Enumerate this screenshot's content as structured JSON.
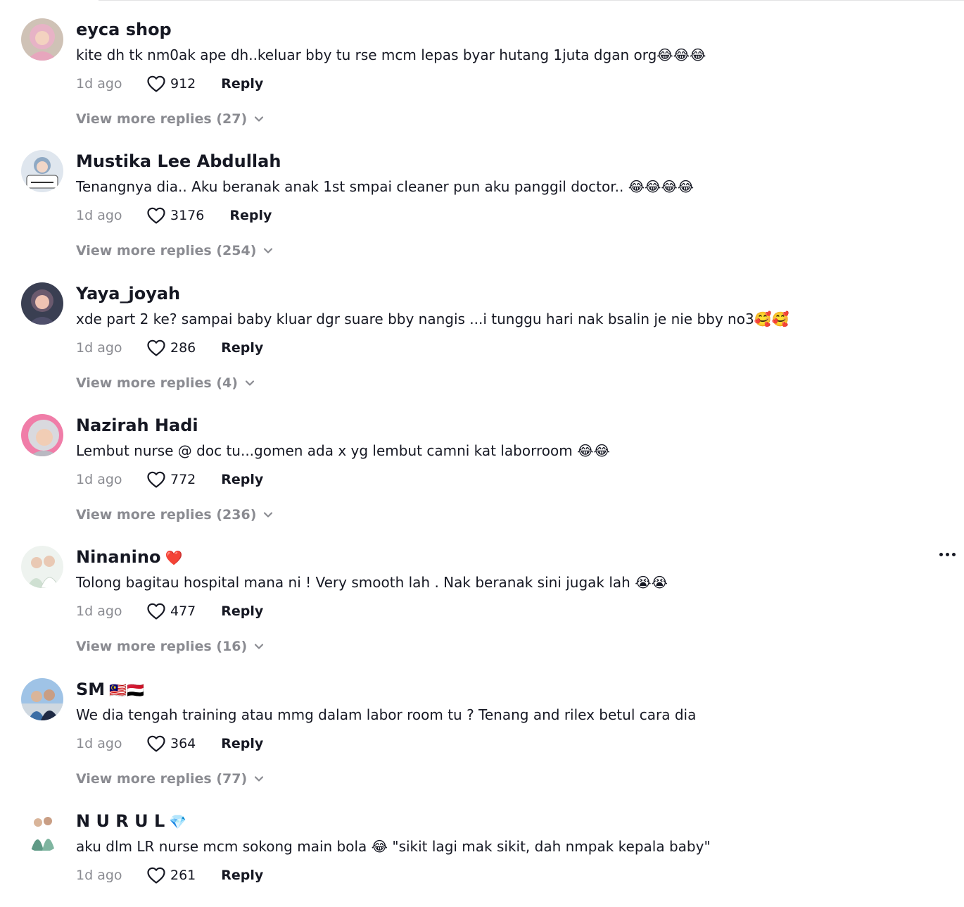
{
  "comments": [
    {
      "username": "eyca shop",
      "tag": "",
      "text": "kite dh tk nm0ak ape dh..keluar bby tu rse mcm lepas byar hutang 1juta dgan org😂😂😂",
      "time": "1d ago",
      "likes": "912",
      "reply_label": "Reply",
      "more_replies": "View more replies (27)",
      "avatar_color": "#e7b3c6"
    },
    {
      "username": "Mustika Lee Abdullah",
      "tag": "",
      "text": "Tenangnya dia.. Aku beranak anak 1st smpai cleaner pun aku panggil doctor.. 😂😂😂😂",
      "time": "1d ago",
      "likes": "3176",
      "reply_label": "Reply",
      "more_replies": "View more replies (254)",
      "avatar_color": "#8fa9c4"
    },
    {
      "username": "Yaya_joyah",
      "tag": "",
      "text": "xde part 2 ke? sampai baby kluar dgr suare bby nangis ...i tunggu hari nak bsalin je nie bby no3🥰🥰",
      "time": "1d ago",
      "likes": "286",
      "reply_label": "Reply",
      "more_replies": "View more replies (4)",
      "avatar_color": "#6b5a6e"
    },
    {
      "username": "Nazirah Hadi",
      "tag": "",
      "text": "Lembut nurse @ doc tu...gomen ada x yg lembut camni kat laborroom 😂😂",
      "time": "1d ago",
      "likes": "772",
      "reply_label": "Reply",
      "more_replies": "View more replies (236)",
      "avatar_color": "#f07da8"
    },
    {
      "username": "Ninanino",
      "tag": "❤️",
      "text": "Tolong bagitau hospital mana ni ! Very smooth lah . Nak beranak sini jugak lah 😭😭",
      "time": "1d ago",
      "likes": "477",
      "reply_label": "Reply",
      "more_replies": "View more replies (16)",
      "avatar_color": "#cfe0d2"
    },
    {
      "username": "SM",
      "tag": "🇲🇾🇾🇪",
      "text": "We dia tengah training atau mmg dalam labor room tu ? Tenang and rilex betul cara dia",
      "time": "1d ago",
      "likes": "364",
      "reply_label": "Reply",
      "more_replies": "View more replies (77)",
      "avatar_color": "#3c6ea5"
    },
    {
      "username": "N U R U L",
      "tag": "💎",
      "text": "aku dlm LR nurse mcm sokong main bola 😂 \"sikit lagi mak sikit, dah nmpak kepala baby\"",
      "time": "1d ago",
      "likes": "261",
      "reply_label": "Reply",
      "more_replies": "",
      "avatar_color": "#5f9a86"
    }
  ],
  "icons": {
    "like": "heart-outline-icon",
    "expand": "chevron-down-icon",
    "more": "more-options-icon"
  }
}
